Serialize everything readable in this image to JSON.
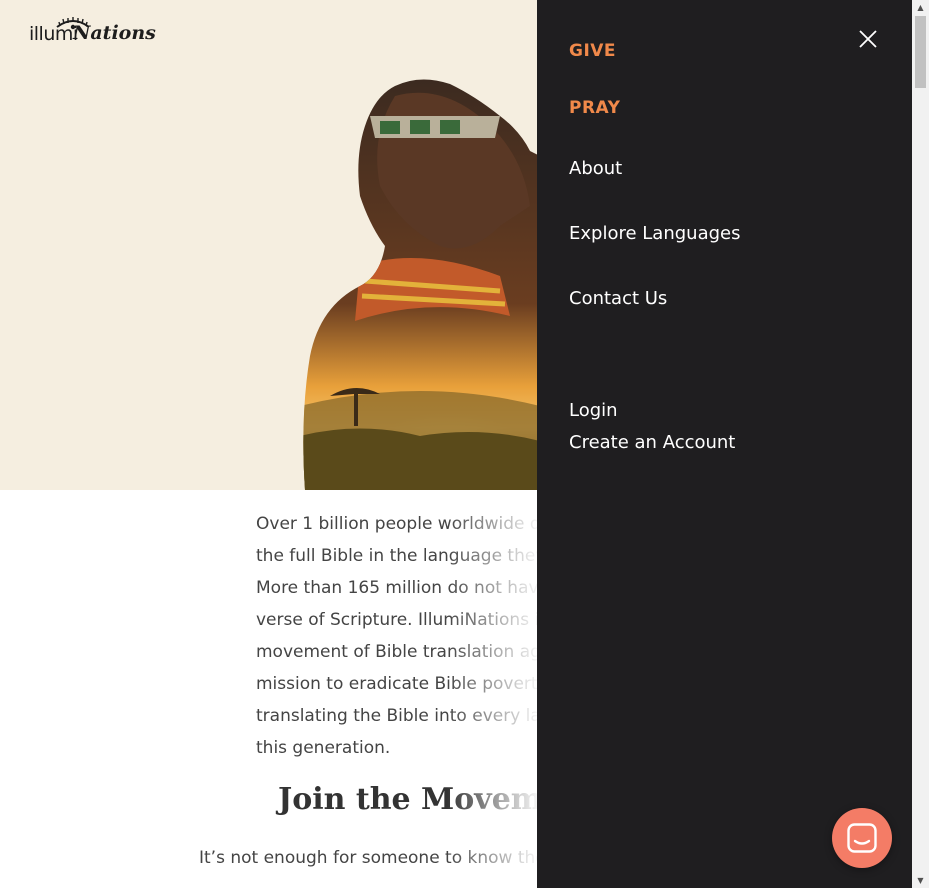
{
  "brand": {
    "logo_part1": "illumi",
    "logo_part2": "Nations"
  },
  "body": {
    "paragraph_lines": [
      "Over 1 billion people worldwide d",
      "the full Bible in the language they",
      "More than 165 million do not hav",
      "verse of Scripture.  IllumiNations i",
      "movement of Bible translation ag",
      "mission to eradicate Bible poverty",
      "translating the Bible into every la",
      "this generation."
    ],
    "heading": "Join the Moveme",
    "paragraph2": "It’s not enough for someone to know the"
  },
  "drawer": {
    "give": "GIVE",
    "pray": "PRAY",
    "about": "About",
    "explore": "Explore Languages",
    "contact": "Contact Us",
    "login": "Login",
    "create_account": "Create an Account"
  },
  "icons": {
    "close": "close-icon",
    "chat": "chat-icon"
  },
  "colors": {
    "accent": "#f0894a",
    "drawer_bg": "#1f1e20",
    "hero_bg": "#f5eee0",
    "chat_bg": "#f47c66"
  }
}
